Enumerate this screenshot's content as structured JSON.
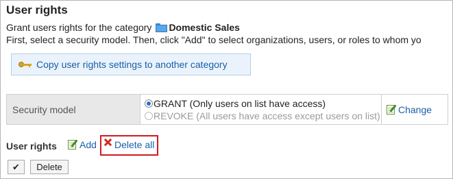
{
  "page": {
    "title": "User rights",
    "intro_prefix": "Grant users rights for the category",
    "category_name": "Domestic Sales",
    "instruction": "First, select a security model. Then, click \"Add\" to select organizations, users, or roles to whom yo"
  },
  "copy_button": {
    "label": "Copy user rights settings to another category",
    "icon": "key-icon"
  },
  "security_model": {
    "label": "Security model",
    "options": [
      {
        "label": "GRANT (Only users on list have access)",
        "checked": true,
        "disabled": false
      },
      {
        "label": "REVOKE (All users have access except users on list)",
        "checked": false,
        "disabled": true
      }
    ],
    "change_label": "Change"
  },
  "user_rights": {
    "label": "User rights",
    "add_label": "Add",
    "delete_all_label": "Delete all",
    "highlight_color": "#d0191f"
  },
  "footer": {
    "check_label": "✔",
    "delete_label": "Delete"
  }
}
